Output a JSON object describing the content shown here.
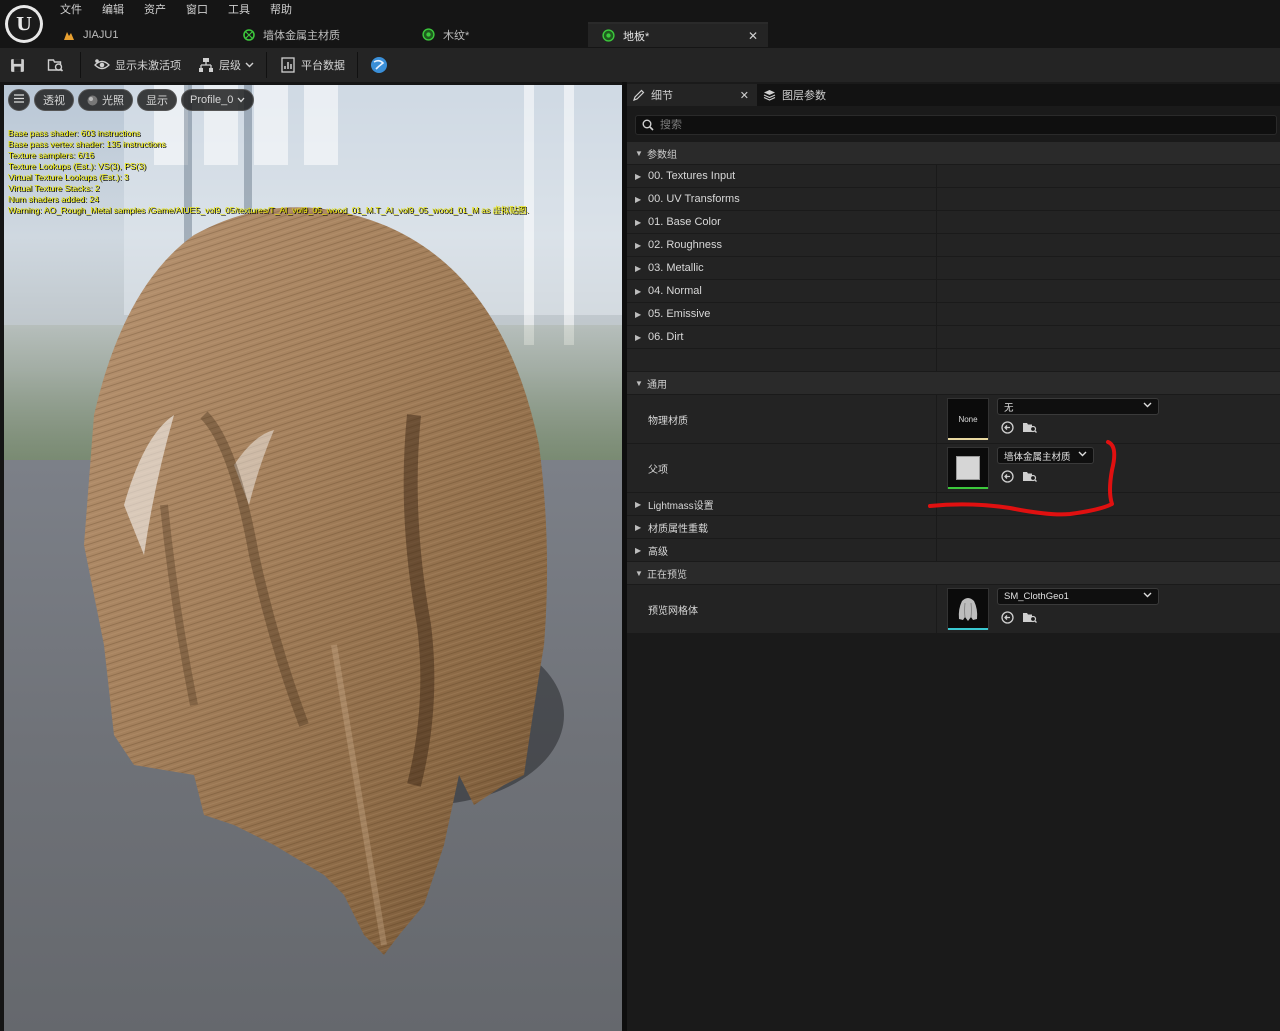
{
  "menu": [
    "文件",
    "编辑",
    "资产",
    "窗口",
    "工具",
    "帮助"
  ],
  "tabs": [
    {
      "label": "JIAJU1",
      "icon": "level-icon"
    },
    {
      "label": "墙体金属主材质",
      "icon": "material-icon"
    },
    {
      "label": "木纹*",
      "icon": "material-instance-icon"
    },
    {
      "label": "地板*",
      "icon": "material-instance-icon",
      "active": true
    }
  ],
  "toolbar": {
    "show_inactive": "显示未激活项",
    "hierarchy": "层级",
    "platform_stats": "平台数据"
  },
  "viewport": {
    "perspective": "透视",
    "lit": "光照",
    "show": "显示",
    "profile": "Profile_0",
    "stats": [
      "Base pass shader: 603 instructions",
      "Base pass vertex shader: 135 instructions",
      "Texture samplers: 6/16",
      "Texture Lookups (Est.): VS(3), PS(3)",
      "Virtual Texture Lookups (Est.): 3",
      "Virtual Texture Stacks: 2",
      "Num shaders added: 24",
      "Warning: AO_Rough_Metal samples /Game/AIUE5_vol9_05/textures/T_AI_vol9_05_wood_01_M.T_AI_vol9_05_wood_01_M as 虚拟贴图."
    ]
  },
  "panel": {
    "details_tab": "细节",
    "layer_params_tab": "图层参数",
    "search_placeholder": "搜索",
    "param_groups_label": "参数组",
    "groups": [
      "00. Textures Input",
      "00. UV Transforms",
      "01. Base Color",
      "02. Roughness",
      "03. Metallic",
      "04. Normal",
      "05. Emissive",
      "06. Dirt"
    ],
    "general_label": "通用",
    "phys_material_label": "物理材质",
    "phys_material_thumb": "None",
    "phys_material_value": "无",
    "parent_label": "父项",
    "parent_value": "墙体金属主材质",
    "lightmass_label": "Lightmass设置",
    "override_label": "材质属性重载",
    "advanced_label": "高级",
    "previewing_label": "正在预览",
    "preview_mesh_label": "预览网格体",
    "preview_mesh_value": "SM_ClothGeo1"
  },
  "colors": {
    "annotation": "#e01010",
    "phys_bar": "#e8d8a0",
    "parent_bar": "#3cc83c",
    "mesh_bar": "#39c8d0",
    "stats_text": "#e8e400"
  }
}
